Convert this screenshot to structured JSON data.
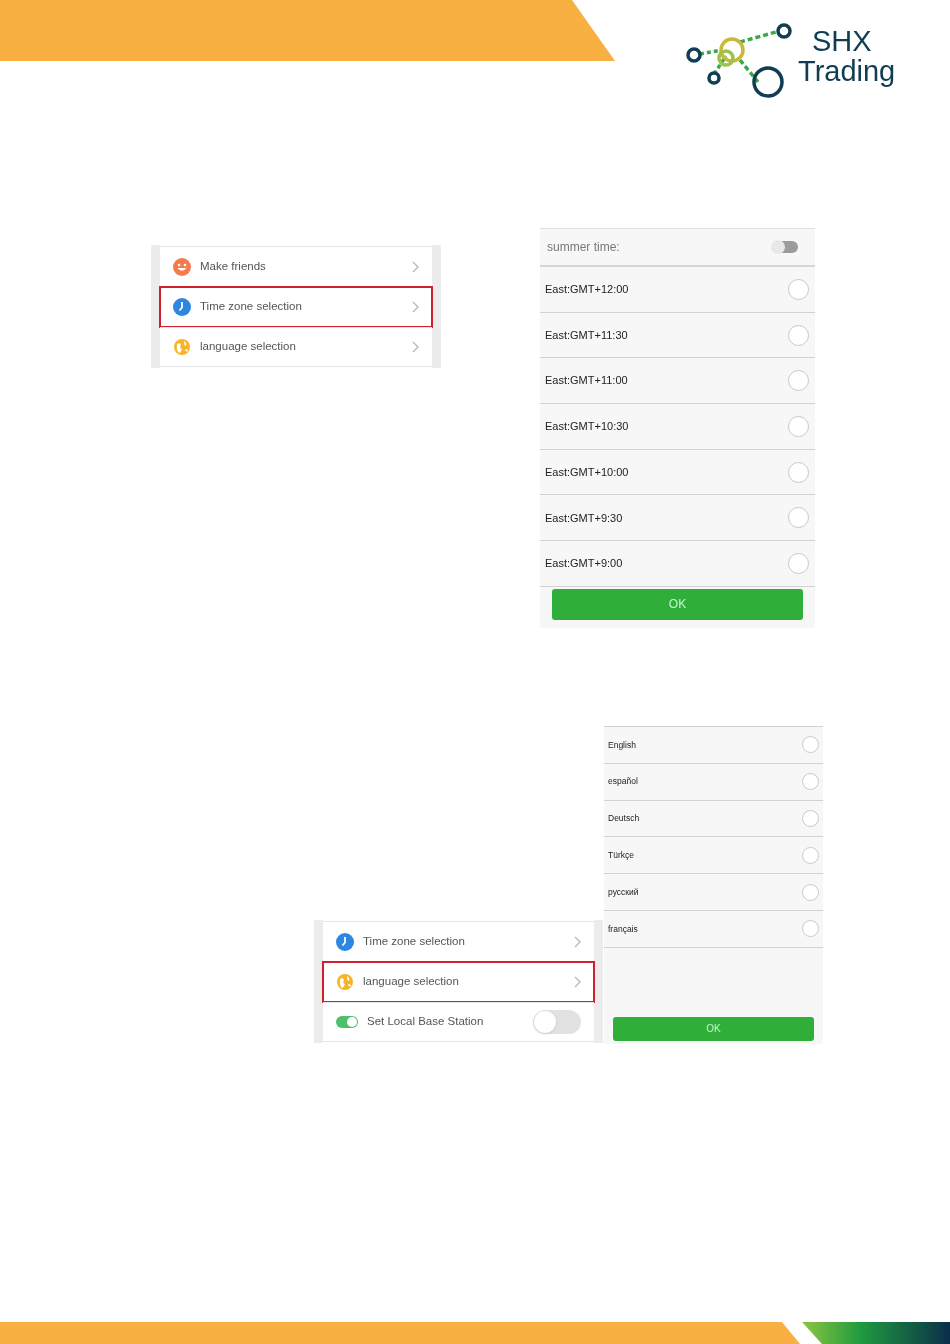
{
  "logo": {
    "line1": "SHX",
    "line2": "Trading"
  },
  "menu_1": {
    "items": [
      {
        "kind": "smiley",
        "label": "Make friends",
        "highlighted": false
      },
      {
        "kind": "clock",
        "label": "Time zone selection",
        "highlighted": true
      },
      {
        "kind": "globe",
        "label": "language selection",
        "highlighted": false
      }
    ]
  },
  "time_zone_panel": {
    "summer_time": {
      "label": "summer time:",
      "on": false
    },
    "options": [
      {
        "label": "East:GMT+12:00",
        "selected": false
      },
      {
        "label": "East:GMT+11:30",
        "selected": false
      },
      {
        "label": "East:GMT+11:00",
        "selected": false
      },
      {
        "label": "East:GMT+10:30",
        "selected": false
      },
      {
        "label": "East:GMT+10:00",
        "selected": false
      },
      {
        "label": "East:GMT+9:30",
        "selected": false
      },
      {
        "label": "East:GMT+9:00",
        "selected": false
      }
    ],
    "ok_button": "OK"
  },
  "language_panel": {
    "options": [
      {
        "label": "English",
        "selected": false
      },
      {
        "label": "español",
        "selected": false
      },
      {
        "label": "Deutsch",
        "selected": false
      },
      {
        "label": "Türkçe",
        "selected": false
      },
      {
        "label": "русский",
        "selected": false
      },
      {
        "label": "français",
        "selected": false
      }
    ],
    "ok_button": "OK"
  },
  "menu_2": {
    "items": [
      {
        "kind": "clock",
        "label": "Time zone selection",
        "highlighted": false
      },
      {
        "kind": "globe",
        "label": "language selection",
        "highlighted": true
      },
      {
        "kind": "switch",
        "label": "Set Local Base Station",
        "highlighted": false,
        "on": false
      }
    ]
  }
}
